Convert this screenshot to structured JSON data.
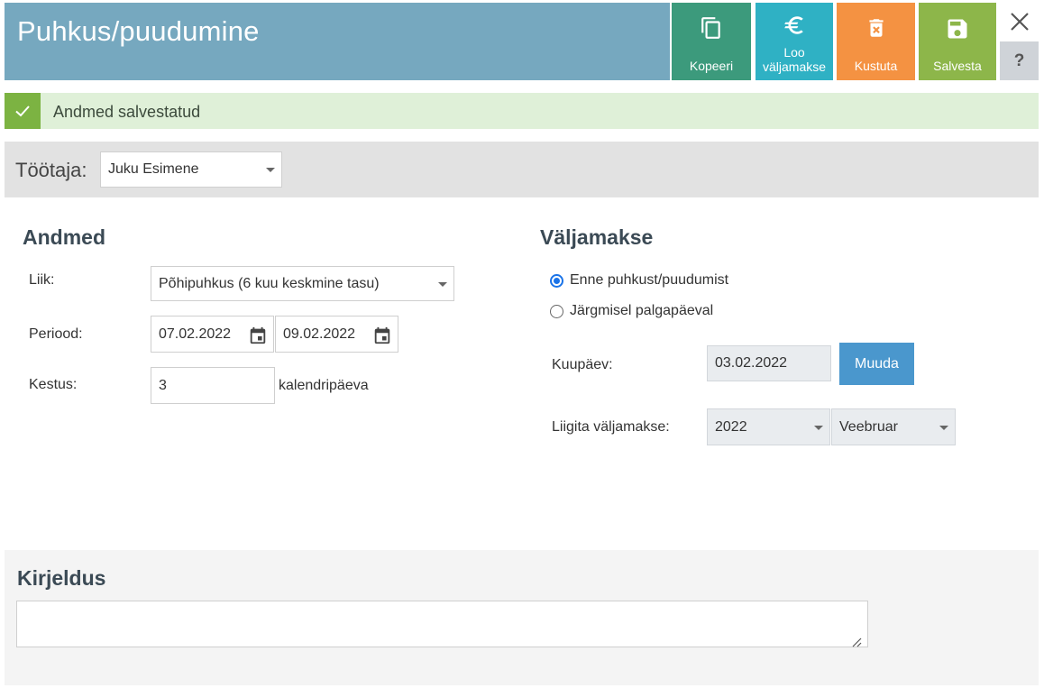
{
  "header": {
    "title": "Puhkus/puudumine"
  },
  "toolbar": {
    "copy_label": "Kopeeri",
    "create_payment_label": "Loo väljamakse",
    "delete_label": "Kustuta",
    "save_label": "Salvesta",
    "help_label": "?"
  },
  "notice": {
    "message": "Andmed salvestatud"
  },
  "employee": {
    "label": "Töötaja:",
    "selected": "Juku Esimene"
  },
  "andmed": {
    "title": "Andmed",
    "type_label": "Liik:",
    "type_value": "Põhipuhkus (6 kuu keskmine tasu)",
    "period_label": "Periood:",
    "period_start": "07.02.2022",
    "period_end": "09.02.2022",
    "duration_label": "Kestus:",
    "duration_value": "3",
    "duration_unit": "kalendripäeva"
  },
  "valjamakse": {
    "title": "Väljamakse",
    "option_before": "Enne puhkust/puudumist",
    "option_next": "Järgmisel palgapäeval",
    "selected_option": "option_before",
    "date_label": "Kuupäev:",
    "date_value": "03.02.2022",
    "change_label": "Muuda",
    "assign_label": "Liigita väljamakse:",
    "year_value": "2022",
    "month_value": "Veebruar"
  },
  "description": {
    "title": "Kirjeldus",
    "value": ""
  },
  "colors": {
    "header_bg": "#76a8bf",
    "copy_bg": "#3c9a7c",
    "payment_bg": "#2fb1c4",
    "delete_bg": "#f49242",
    "save_bg": "#8db64a",
    "success_bg": "#dff0d8",
    "success_accent": "#7cb342",
    "primary_button": "#4a97cd"
  }
}
